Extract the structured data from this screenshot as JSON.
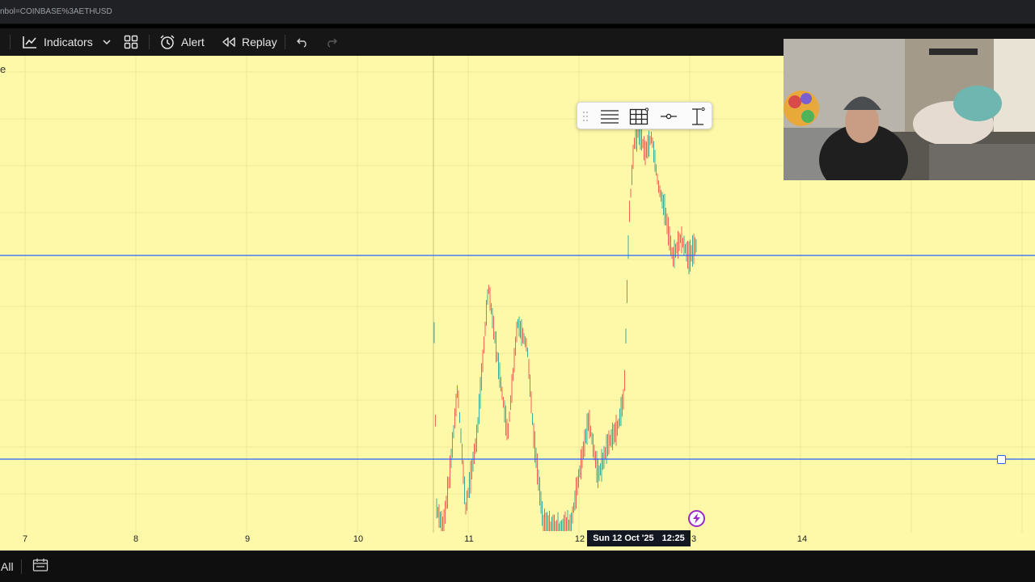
{
  "browser": {
    "url_fragment": "nbol=COINBASE%3AETHUSD"
  },
  "toolbar": {
    "indicators_label": "Indicators",
    "alert_label": "Alert",
    "replay_label": "Replay"
  },
  "chart": {
    "corner_text": "e",
    "background_color": "#fdf9a8",
    "horizontal_line_color": "#2962ff",
    "x_axis_labels": [
      "7",
      "8",
      "9",
      "10",
      "11",
      "12",
      "3",
      "14"
    ],
    "crosshair_date": "Sun 12 Oct '25",
    "crosshair_time": "12:25"
  },
  "bottom": {
    "range_label": "All"
  },
  "icons": {
    "indicators": "chart-line-icon",
    "dropdown": "chevron-down-icon",
    "templates": "grid-squares-icon",
    "alert": "alarm-clock-plus-icon",
    "replay": "rewind-icon",
    "undo": "undo-icon",
    "redo": "redo-icon",
    "float_drag": "drag-handle-icon",
    "float_lines": "horizontal-lines-icon",
    "float_grid": "grid-icon",
    "float_line": "line-tool-icon",
    "float_range": "price-range-icon",
    "lightning": "lightning-icon",
    "calendar": "calendar-icon"
  }
}
